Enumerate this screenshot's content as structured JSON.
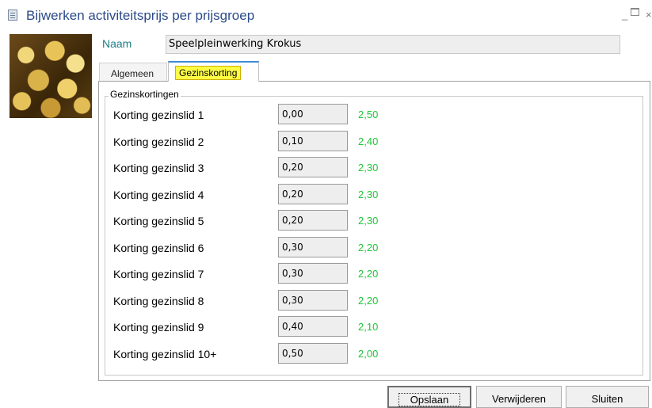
{
  "window": {
    "title": "Bijwerken activiteitsprijs per prijsgroep",
    "controls": {
      "minimize": "_",
      "close": "×"
    }
  },
  "form": {
    "naam_label": "Naam",
    "naam_value": "Speelpleinwerking Krokus"
  },
  "tabs": [
    {
      "label": "Algemeen",
      "active": false
    },
    {
      "label": "Gezinskorting",
      "active": true
    }
  ],
  "group": {
    "legend": "Gezinskortingen",
    "rows": [
      {
        "label": "Korting gezinslid 1",
        "value": "0,00",
        "result": "2,50"
      },
      {
        "label": "Korting gezinslid 2",
        "value": "0,10",
        "result": "2,40"
      },
      {
        "label": "Korting gezinslid 3",
        "value": "0,20",
        "result": "2,30"
      },
      {
        "label": "Korting gezinslid 4",
        "value": "0,20",
        "result": "2,30"
      },
      {
        "label": "Korting gezinslid 5",
        "value": "0,20",
        "result": "2,30"
      },
      {
        "label": "Korting gezinslid 6",
        "value": "0,30",
        "result": "2,20"
      },
      {
        "label": "Korting gezinslid 7",
        "value": "0,30",
        "result": "2,20"
      },
      {
        "label": "Korting gezinslid 8",
        "value": "0,30",
        "result": "2,20"
      },
      {
        "label": "Korting gezinslid 9",
        "value": "0,40",
        "result": "2,10"
      },
      {
        "label": "Korting gezinslid 10+",
        "value": "0,50",
        "result": "2,00"
      }
    ]
  },
  "buttons": {
    "save": "Opslaan",
    "delete": "Verwijderen",
    "close": "Sluiten"
  },
  "colors": {
    "title": "#2b4a8a",
    "naam_label": "#1a7f86",
    "result_green": "#22c53a",
    "active_tab_highlight": "#ffff44",
    "active_tab_border": "#3c8dd8"
  }
}
